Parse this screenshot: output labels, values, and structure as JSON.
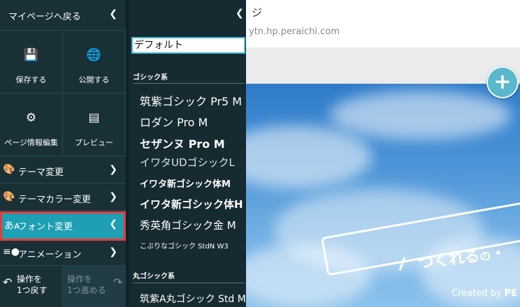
{
  "sidebar": {
    "back_label": "マイページへ戻る",
    "tiles": [
      {
        "label": "保存する",
        "icon": "save-icon"
      },
      {
        "label": "公開する",
        "icon": "globe-icon"
      },
      {
        "label": "ページ情報編集",
        "icon": "gear-icon"
      },
      {
        "label": "プレビュー",
        "icon": "preview-icon"
      }
    ],
    "menu": [
      {
        "label": "テーマ変更",
        "icon": "palette-icon"
      },
      {
        "label": "テーマカラー変更",
        "icon": "palette-icon"
      },
      {
        "label": "フォント変更",
        "icon": "font-icon",
        "active": true
      },
      {
        "label": "アニメーション",
        "icon": "animation-icon"
      }
    ],
    "undo_label": "操作を\n1つ戻す",
    "redo_label": "操作を\n1つ進める"
  },
  "font_panel": {
    "selected_font": "デフォルト",
    "categories": [
      {
        "name": "ゴシック系",
        "fonts": [
          "筑紫ゴシック Pr5 M",
          "ロダン Pro M",
          "セザンヌ Pro M",
          "イワタUDゴシックL",
          "イワタ新ゴシック体M",
          "イワタ新ゴシック体H",
          "秀英角ゴシック金 M",
          "こぶりなゴシック StdN W3"
        ]
      },
      {
        "name": "丸ゴシック系",
        "fonts": [
          "筑紫A丸ゴシック Std M"
        ]
      }
    ]
  },
  "preview": {
    "title": "ジ",
    "url": "ytn.hp.peraichi.com",
    "banner_text": "つくれる",
    "banner_text_suffix": "の",
    "banner_text_tail": "・",
    "created_by": "Created by",
    "created_by_brand": "PE",
    "add_button": "+"
  },
  "colors": {
    "sidebar_bg": "#193037",
    "active_item_bg": "#1e9fb3",
    "active_item_border": "#e63a3a",
    "input_border": "#4bbcd0"
  }
}
